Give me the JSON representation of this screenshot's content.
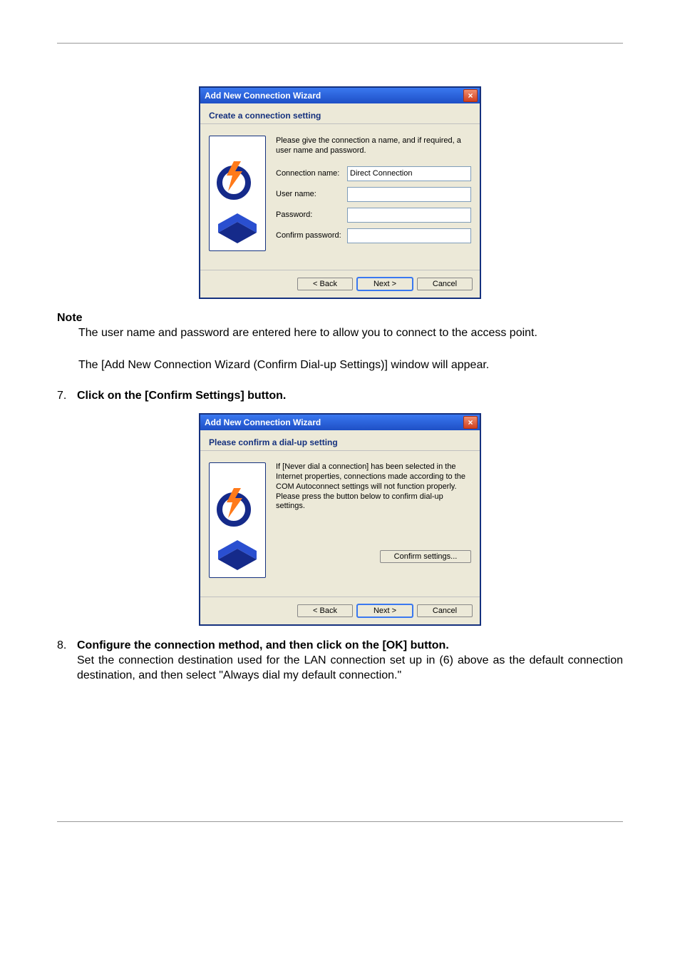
{
  "dialog1": {
    "title": "Add New Connection Wizard",
    "step_header": "Create a connection setting",
    "intro": "Please give the connection a name, and if required, a user name and password.",
    "labels": {
      "conn_name": "Connection name:",
      "user_name": "User name:",
      "password": "Password:",
      "confirm_pw": "Confirm password:"
    },
    "values": {
      "conn_name": "Direct Connection",
      "user_name": "",
      "password": "",
      "confirm_pw": ""
    },
    "buttons": {
      "back": "< Back",
      "next": "Next >",
      "cancel": "Cancel"
    }
  },
  "note_heading": "Note",
  "note_text": "The user name and password are entered here to allow you to connect to the access point.",
  "para_wizard": "The [Add New Connection Wizard (Confirm Dial-up Settings)] window will appear.",
  "step7": {
    "num": "7.",
    "text": "Click on the [Confirm Settings] button."
  },
  "dialog2": {
    "title": "Add New Connection Wizard",
    "step_header": "Please confirm a dial-up setting",
    "body_text": "If [Never dial a connection] has been selected in the Internet properties, connections made according to the COM Autoconnect settings will not function properly. Please press the button below to confirm dial-up settings.",
    "confirm_button": "Confirm settings...",
    "buttons": {
      "back": "< Back",
      "next": "Next >",
      "cancel": "Cancel"
    }
  },
  "step8": {
    "num": "8.",
    "bold": "Configure the connection method, and then click on the [OK] button.",
    "rest": "Set the connection destination used for the LAN connection set up in (6) above as the default connection destination, and then select \"Always dial my default connection.\""
  }
}
